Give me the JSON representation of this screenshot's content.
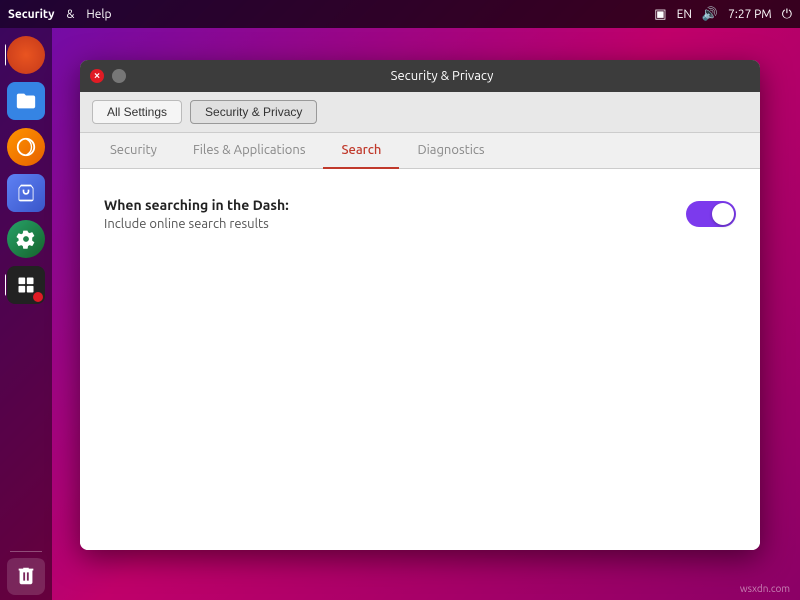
{
  "menubar": {
    "app_name": "Security",
    "separator": "&",
    "help": "Help",
    "indicators": {
      "display_icon": "▣",
      "lang": "EN",
      "volume_icon": "🔊",
      "time": "7:27 PM",
      "power_icon": "⏻"
    }
  },
  "dock": {
    "items": [
      {
        "name": "ubuntu-logo",
        "label": "Ubuntu"
      },
      {
        "name": "files",
        "label": "Files"
      },
      {
        "name": "firefox",
        "label": "Firefox"
      },
      {
        "name": "software",
        "label": "Software"
      },
      {
        "name": "settings",
        "label": "Settings"
      },
      {
        "name": "security-app",
        "label": "Security"
      }
    ],
    "trash_label": "Trash"
  },
  "window": {
    "title": "Security & Privacy",
    "close_btn": "×",
    "breadcrumb": {
      "all_settings": "All Settings",
      "security_privacy": "Security & Privacy"
    },
    "tabs": [
      {
        "label": "Security",
        "active": false
      },
      {
        "label": "Files & Applications",
        "active": false
      },
      {
        "label": "Search",
        "active": true
      },
      {
        "label": "Diagnostics",
        "active": false
      }
    ],
    "content": {
      "section_title": "When searching in the Dash:",
      "setting_label": "Include online search results",
      "toggle_on": true
    }
  },
  "watermark": "wsxdn.com"
}
